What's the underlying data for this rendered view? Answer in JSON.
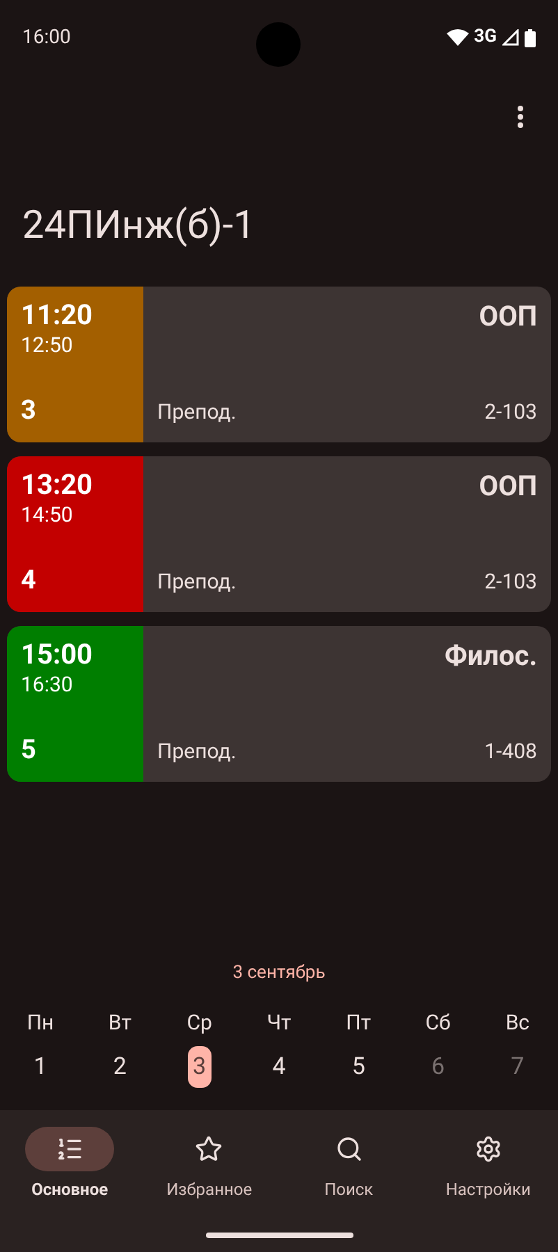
{
  "status_bar": {
    "time": "16:00",
    "network": "3G"
  },
  "title": "24ПИнж(б)-1",
  "lessons": [
    {
      "start": "11:20",
      "end": "12:50",
      "number": "3",
      "color": "#a35f00",
      "subject": "ООП",
      "teacher": "Препод.",
      "room": "2-103"
    },
    {
      "start": "13:20",
      "end": "14:50",
      "number": "4",
      "color": "#c30000",
      "subject": "ООП",
      "teacher": "Препод.",
      "room": "2-103"
    },
    {
      "start": "15:00",
      "end": "16:30",
      "number": "5",
      "color": "#007e00",
      "subject": "Филос.",
      "teacher": "Препод.",
      "room": "1-408"
    }
  ],
  "date_label": "3 сентябрь",
  "days": [
    {
      "weekday": "Пн",
      "day": "1",
      "selected": false,
      "disabled": false
    },
    {
      "weekday": "Вт",
      "day": "2",
      "selected": false,
      "disabled": false
    },
    {
      "weekday": "Ср",
      "day": "3",
      "selected": true,
      "disabled": false
    },
    {
      "weekday": "Чт",
      "day": "4",
      "selected": false,
      "disabled": false
    },
    {
      "weekday": "Пт",
      "day": "5",
      "selected": false,
      "disabled": false
    },
    {
      "weekday": "Сб",
      "day": "6",
      "selected": false,
      "disabled": true
    },
    {
      "weekday": "Вс",
      "day": "7",
      "selected": false,
      "disabled": true
    }
  ],
  "nav": [
    {
      "label": "Основное",
      "kind": "list",
      "selected": true
    },
    {
      "label": "Избранное",
      "kind": "star",
      "selected": false
    },
    {
      "label": "Поиск",
      "kind": "search",
      "selected": false
    },
    {
      "label": "Настройки",
      "kind": "settings",
      "selected": false
    }
  ]
}
